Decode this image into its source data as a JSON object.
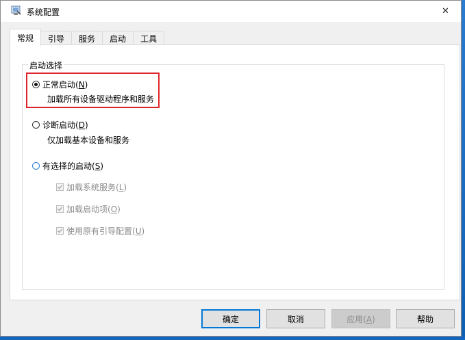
{
  "window": {
    "title": "系统配置",
    "close_glyph": "✕"
  },
  "tabs": [
    {
      "label": "常规",
      "active": true
    },
    {
      "label": "引导",
      "active": false
    },
    {
      "label": "服务",
      "active": false
    },
    {
      "label": "启动",
      "active": false
    },
    {
      "label": "工具",
      "active": false
    }
  ],
  "startup_group": {
    "title": "启动选择",
    "normal": {
      "label": "正常启动(",
      "key": "N",
      "suffix": ")",
      "desc": "加载所有设备驱动程序和服务",
      "checked": true
    },
    "diagnostic": {
      "label": "诊断启动(",
      "key": "D",
      "suffix": ")",
      "desc": "仅加载基本设备和服务",
      "checked": false
    },
    "selective": {
      "label": "有选择的启动(",
      "key": "S",
      "suffix": ")",
      "checked": false,
      "options": [
        {
          "label": "加载系统服务(",
          "key": "L",
          "suffix": ")",
          "checked": true
        },
        {
          "label": "加载启动项(",
          "key": "O",
          "suffix": ")",
          "checked": true
        },
        {
          "label": "使用原有引导配置(",
          "key": "U",
          "suffix": ")",
          "checked": true
        }
      ]
    }
  },
  "buttons": {
    "ok": "确定",
    "cancel": "取消",
    "apply": {
      "label": "应用(",
      "key": "A",
      "suffix": ")"
    },
    "help": "帮助"
  },
  "colors": {
    "highlight": "#e0262c",
    "default_button_border": "#0078d7",
    "desktop": "#1b6ec2"
  }
}
